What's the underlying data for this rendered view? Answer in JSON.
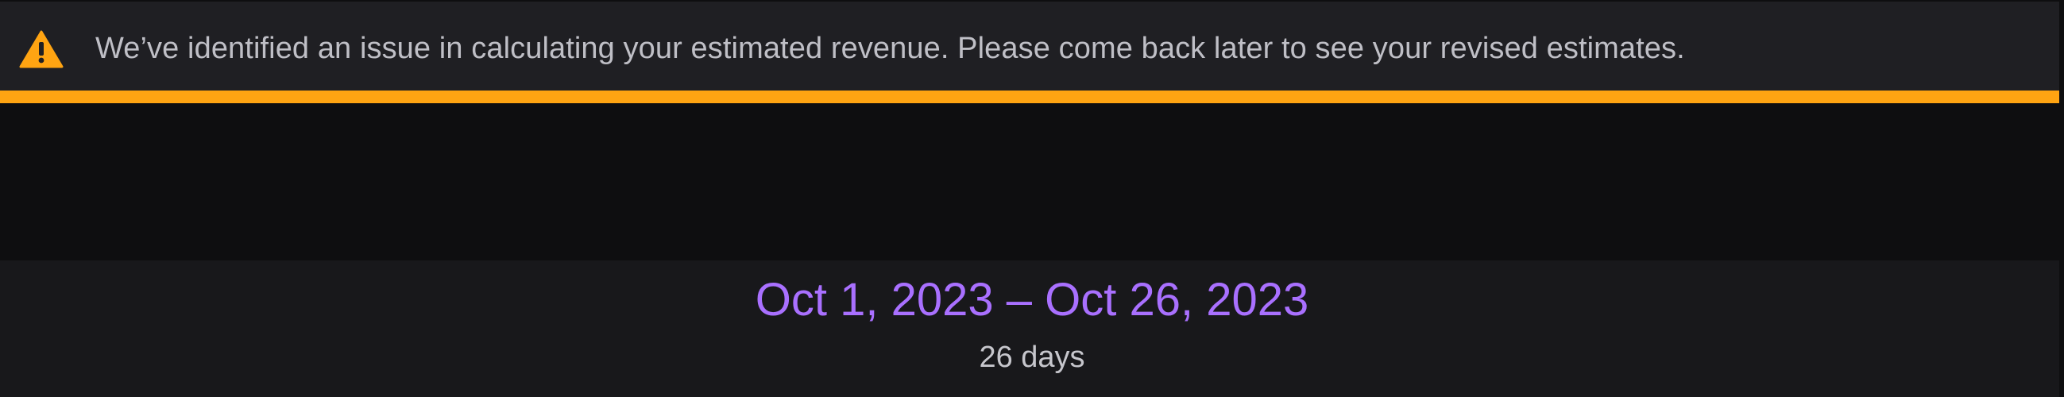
{
  "banner": {
    "icon": "warning-icon",
    "icon_color": "#ffa412",
    "accent_color": "#ffa412",
    "message": "We’ve identified an issue in calculating your estimated revenue. Please come back later to see your revised estimates."
  },
  "date_range": {
    "label": "Oct 1, 2023 – Oct 26, 2023",
    "label_color": "#a970ff",
    "days": "26 days"
  }
}
